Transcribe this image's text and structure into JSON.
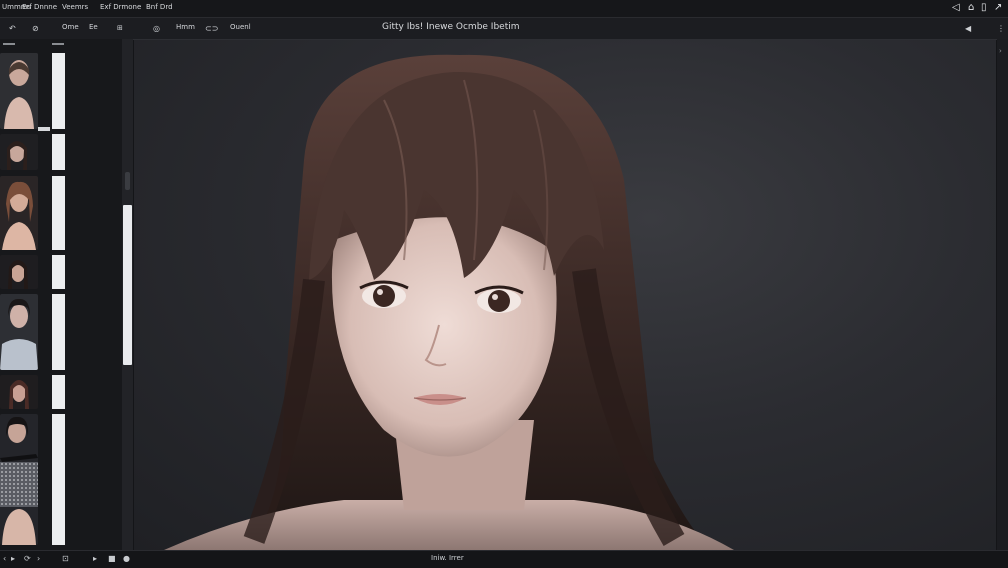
{
  "menubar": {
    "items": [
      "Ummms",
      "Erf Dnnne",
      "Veemrs",
      "Exf Drmone",
      "Bnf Drd"
    ],
    "right_icons": [
      "navigate-icon",
      "lock-icon",
      "user-icon",
      "share-icon"
    ]
  },
  "toolbar": {
    "buttons": [
      "undo-icon",
      "link-icon"
    ],
    "tool_labels": [
      "Ome",
      "Ee"
    ],
    "view_labels": [
      "Hmm",
      "Ouenl"
    ],
    "document_title": "Gitty Ibs! Inewe Ocmbe Ibetim",
    "right_icons": [
      "pin-icon",
      "menu-icon"
    ]
  },
  "status": {
    "zoom_text": "Iniw. Irrer",
    "left_icons": [
      "back-icon",
      "undo-icon",
      "redo-icon",
      "loop-icon",
      "forward-icon"
    ],
    "right_icons": [
      "stop-icon",
      "record-icon"
    ]
  },
  "colors": {
    "background": "#141518",
    "canvas": "#2b2c31",
    "hair": "#3a2a26",
    "skin": "#d9c6c0"
  }
}
